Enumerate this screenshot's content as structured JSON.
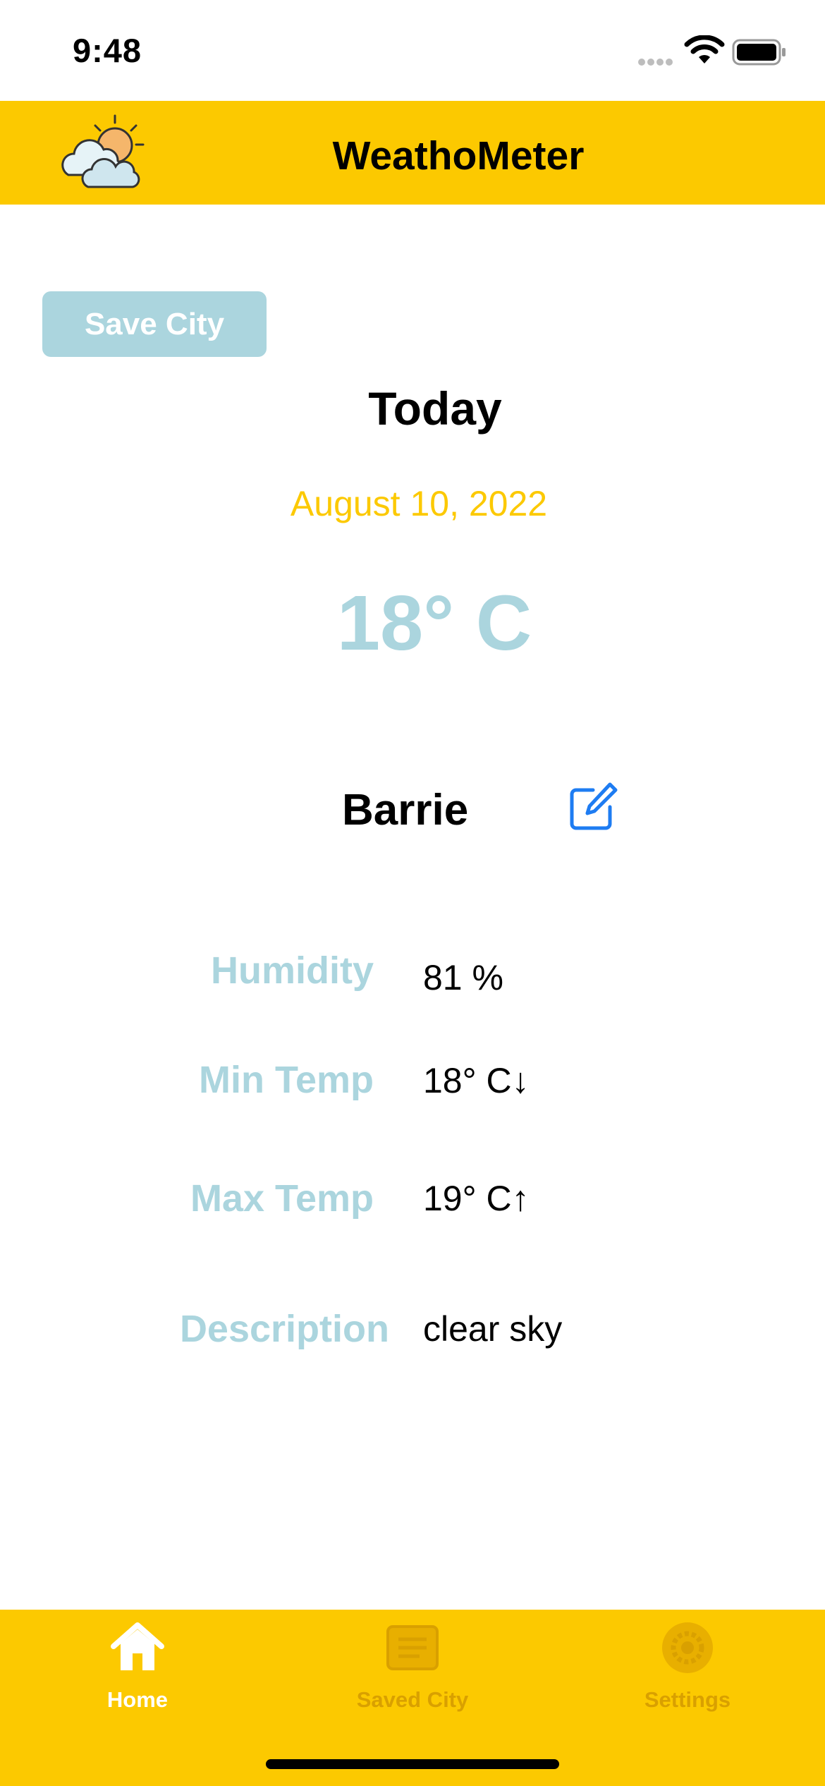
{
  "status_bar": {
    "time": "9:48"
  },
  "header": {
    "title": "WeathoMeter",
    "logo_icon": "sun-behind-cloud-icon"
  },
  "save_city": {
    "label": "Save City"
  },
  "weather": {
    "heading": "Today",
    "date": "August 10, 2022",
    "temperature": "18° C",
    "city": "Barrie",
    "edit_icon": "edit-icon"
  },
  "details": [
    {
      "label": "Humidity",
      "value": "81 %"
    },
    {
      "label": "Min Temp",
      "value": "18° C↓"
    },
    {
      "label": "Max Temp",
      "value": "19° C↑"
    },
    {
      "label": "Description",
      "value": "clear sky"
    }
  ],
  "tabs": [
    {
      "label": "Home",
      "icon": "home-icon",
      "active": true
    },
    {
      "label": "Saved City",
      "icon": "list-icon",
      "active": false
    },
    {
      "label": "Settings",
      "icon": "gear-icon",
      "active": false
    }
  ],
  "colors": {
    "accent_yellow": "#FCC900",
    "light_blue": "#ABD5DE",
    "link_blue": "#1E7CF2",
    "inactive_tab": "#D9A000"
  }
}
